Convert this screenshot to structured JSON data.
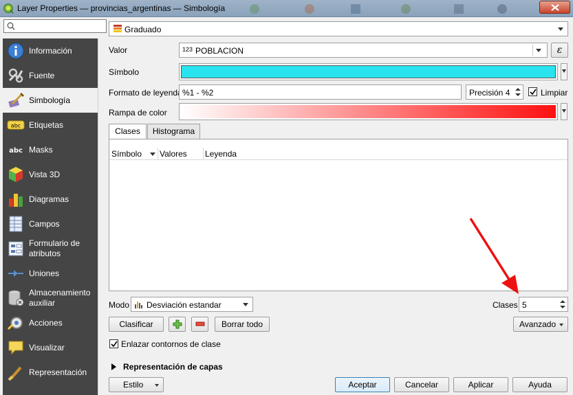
{
  "window": {
    "title": "Layer Properties — provincias_argentinas — Simbología"
  },
  "sidebar": {
    "search_placeholder": "",
    "items": [
      {
        "label": "Información",
        "icon": "info-icon"
      },
      {
        "label": "Fuente",
        "icon": "source-icon"
      },
      {
        "label": "Simbología",
        "icon": "symbology-icon",
        "active": true
      },
      {
        "label": "Etiquetas",
        "icon": "labels-icon"
      },
      {
        "label": "Masks",
        "icon": "masks-icon"
      },
      {
        "label": "Vista 3D",
        "icon": "3d-view-icon"
      },
      {
        "label": "Diagramas",
        "icon": "diagrams-icon"
      },
      {
        "label": "Campos",
        "icon": "fields-icon"
      },
      {
        "label": "Formulario de atributos",
        "icon": "attribute-form-icon"
      },
      {
        "label": "Uniones",
        "icon": "joins-icon"
      },
      {
        "label": "Almacenamiento auxiliar",
        "icon": "auxiliary-storage-icon"
      },
      {
        "label": "Acciones",
        "icon": "actions-icon"
      },
      {
        "label": "Visualizar",
        "icon": "display-icon"
      },
      {
        "label": "Representación",
        "icon": "rendering-icon"
      }
    ]
  },
  "renderer": {
    "type": "Graduado"
  },
  "form": {
    "valor_label": "Valor",
    "valor_prefix": "123",
    "valor_value": "POBLACION",
    "simbolo_label": "Símbolo",
    "symbol_color": "#29e3ee",
    "formato_label": "Formato de leyenda",
    "formato_value": "%1 - %2",
    "precision_label": "Precisión 4",
    "limpiar_label": "Limpiar",
    "rampa_label": "Rampa de color",
    "ramp_start_color": "#ffffff",
    "ramp_end_color": "#ff1010"
  },
  "tabs": [
    {
      "label": "Clases"
    },
    {
      "label": "Histograma"
    }
  ],
  "table": {
    "columns": [
      "Símbolo",
      "Valores",
      "Leyenda"
    ]
  },
  "mode": {
    "label": "Modo",
    "value": "Desviación estandar",
    "classes_label": "Clases",
    "classes_value": "5"
  },
  "buttons": {
    "clasificar": "Clasificar",
    "borrar_todo": "Borrar todo",
    "avanzado": "Avanzado",
    "estilo": "Estilo",
    "aceptar": "Aceptar",
    "cancelar": "Cancelar",
    "aplicar": "Aplicar",
    "ayuda": "Ayuda"
  },
  "link_contours_label": "Enlazar contornos de clase",
  "layer_rendering_label": "Representación de capas",
  "annotation_color": "#ee1111"
}
